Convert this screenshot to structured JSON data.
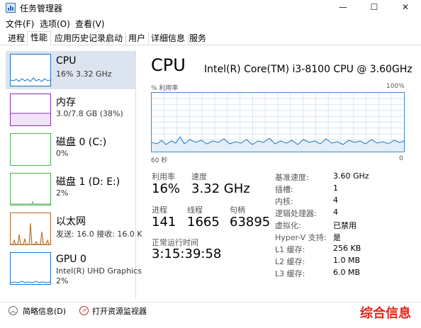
{
  "window": {
    "title": "任务管理器",
    "minimize": "—",
    "maximize": "☐",
    "close": "✕"
  },
  "menu": [
    "文件(F)",
    "选项(O)",
    "查看(V)"
  ],
  "tabs": [
    "进程",
    "性能",
    "应用历史记录",
    "启动",
    "用户",
    "详细信息",
    "服务"
  ],
  "sidebar": {
    "items": [
      {
        "title": "CPU",
        "sub": "16% 3.32 GHz",
        "sub2": ""
      },
      {
        "title": "内存",
        "sub": "3.0/7.8 GB (38%)",
        "sub2": ""
      },
      {
        "title": "磁盘 0 (C:)",
        "sub": "0%",
        "sub2": ""
      },
      {
        "title": "磁盘 1 (D: E:)",
        "sub": "2%",
        "sub2": ""
      },
      {
        "title": "以太网",
        "sub": "发送: 16.0  接收: 16.0 K",
        "sub2": ""
      },
      {
        "title": "GPU 0",
        "sub": "Intel(R) UHD Graphics",
        "sub2": "2%"
      }
    ]
  },
  "main": {
    "title": "CPU",
    "model": "Intel(R) Core(TM) i3-8100 CPU @ 3.60GHz",
    "graph_ylabel": "% 利用率",
    "graph_ymax": "100%",
    "graph_xleft": "60 秒",
    "graph_xright": "0",
    "stats": {
      "utilization_label": "利用率",
      "utilization": "16%",
      "speed_label": "速度",
      "speed": "3.32 GHz",
      "processes_label": "进程",
      "processes": "141",
      "threads_label": "线程",
      "threads": "1665",
      "handles_label": "句柄",
      "handles": "63895",
      "uptime_label": "正常运行时间",
      "uptime": "3:15:39:58"
    },
    "specs": [
      {
        "label": "基准速度:",
        "value": "3.60 GHz"
      },
      {
        "label": "插槽:",
        "value": "1"
      },
      {
        "label": "内核:",
        "value": "4"
      },
      {
        "label": "逻辑处理器:",
        "value": "4"
      },
      {
        "label": "虚拟化:",
        "value": "已禁用"
      },
      {
        "label": "Hyper-V 支持:",
        "value": "是"
      },
      {
        "label": "L1 缓存:",
        "value": "256 KB"
      },
      {
        "label": "L2 缓存:",
        "value": "1.0 MB"
      },
      {
        "label": "L3 缓存:",
        "value": "6.0 MB"
      }
    ]
  },
  "footer": {
    "summary": "简略信息(D)",
    "resource_monitor": "打开资源监视器"
  },
  "watermark": "综合信息",
  "colors": {
    "cpu": "#1a73c4",
    "memory": "#8b2bb5",
    "disk": "#4caf50",
    "ethernet": "#b5651d",
    "gpu": "#1a73c4",
    "selected": "#dbe4ef",
    "watermark": "#e1261c"
  }
}
